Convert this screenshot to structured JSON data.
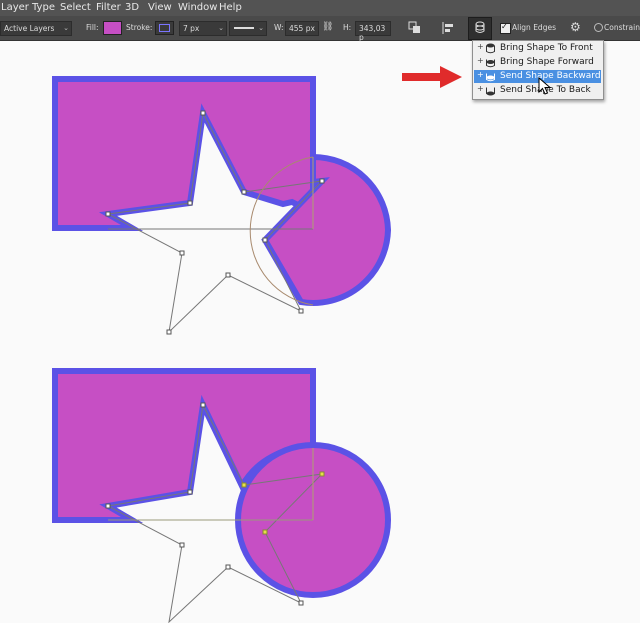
{
  "menu": {
    "items": [
      "Layer",
      "Type",
      "Select",
      "Filter",
      "3D",
      "View",
      "Window",
      "Help"
    ]
  },
  "options_bar": {
    "layers_dropdown": "Active Layers",
    "fill_label": "Fill:",
    "fill_color": "#c64fc4",
    "stroke_label": "Stroke:",
    "stroke_color": "#5b52e6",
    "stroke_size": "7 px",
    "width_label": "W:",
    "width_value": "455 px",
    "height_label": "H:",
    "height_value": "343,03 p",
    "align_edges_label": "Align Edges",
    "align_edges_checked": true,
    "constrain_label": "Constrain P"
  },
  "arrange_menu": {
    "items": [
      {
        "label": "Bring Shape To Front",
        "selected": false
      },
      {
        "label": "Bring Shape Forward",
        "selected": false
      },
      {
        "label": "Send Shape Backward",
        "selected": true
      },
      {
        "label": "Send Shape To Back",
        "selected": false
      }
    ]
  },
  "colors": {
    "shape_fill": "#c64fc4",
    "shape_stroke": "#5b52e6",
    "callout_arrow": "#e02b2b",
    "selection_highlight": "#4a90e2"
  }
}
